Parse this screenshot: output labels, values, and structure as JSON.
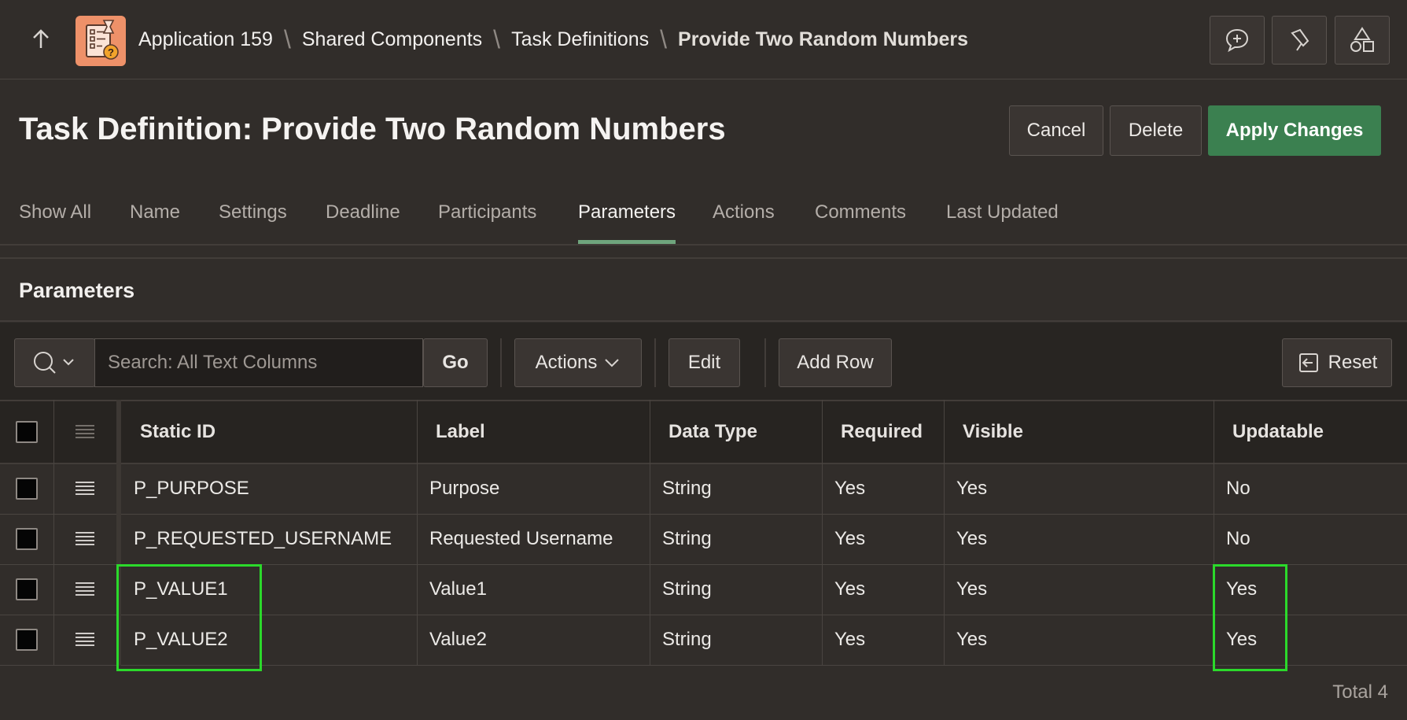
{
  "breadcrumb": {
    "items": [
      "Application 159",
      "Shared Components",
      "Task Definitions"
    ],
    "current": "Provide Two Random Numbers",
    "separator": "\\"
  },
  "toolbar_icons": [
    "feedback-icon",
    "flashlight-icon",
    "shapes-icon"
  ],
  "page": {
    "title": "Task Definition: Provide Two Random Numbers",
    "cancel_label": "Cancel",
    "delete_label": "Delete",
    "apply_label": "Apply Changes"
  },
  "tabs": [
    {
      "label": "Show All"
    },
    {
      "label": "Name"
    },
    {
      "label": "Settings"
    },
    {
      "label": "Deadline"
    },
    {
      "label": "Participants"
    },
    {
      "label": "Parameters",
      "active": true
    },
    {
      "label": "Actions"
    },
    {
      "label": "Comments"
    },
    {
      "label": "Last Updated"
    }
  ],
  "region": {
    "title": "Parameters",
    "search_placeholder": "Search: All Text Columns",
    "go_label": "Go",
    "actions_label": "Actions",
    "edit_label": "Edit",
    "add_row_label": "Add Row",
    "reset_label": "Reset",
    "total_label": "Total 4"
  },
  "grid": {
    "columns": [
      "Static ID",
      "Label",
      "Data Type",
      "Required",
      "Visible",
      "Updatable"
    ],
    "rows": [
      [
        "P_PURPOSE",
        "Purpose",
        "String",
        "Yes",
        "Yes",
        "No"
      ],
      [
        "P_REQUESTED_USERNAME",
        "Requested Username",
        "String",
        "Yes",
        "Yes",
        "No"
      ],
      [
        "P_VALUE1",
        "Value1",
        "String",
        "Yes",
        "Yes",
        "Yes"
      ],
      [
        "P_VALUE2",
        "Value2",
        "String",
        "Yes",
        "Yes",
        "Yes"
      ]
    ]
  },
  "colors": {
    "background": "#312d2a",
    "primary_button": "#3b8050",
    "active_tab_underline": "#6fa57d",
    "highlight_box": "#2bd92b",
    "app_icon": "#ee9169"
  }
}
